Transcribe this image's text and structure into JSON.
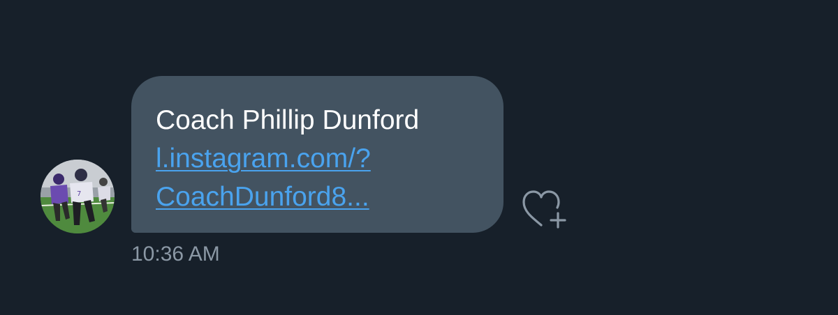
{
  "message": {
    "text": "Coach Phillip Dunford",
    "link_text": "l.instagram.com/?\nCoachDunford8...",
    "timestamp": "10:36 AM"
  },
  "icons": {
    "avatar": "profile-photo-football",
    "reaction": "heart-plus-icon"
  },
  "colors": {
    "background": "#17202a",
    "bubble": "#435361",
    "link": "#4aa3ee",
    "timestamp": "#8b98a5"
  }
}
